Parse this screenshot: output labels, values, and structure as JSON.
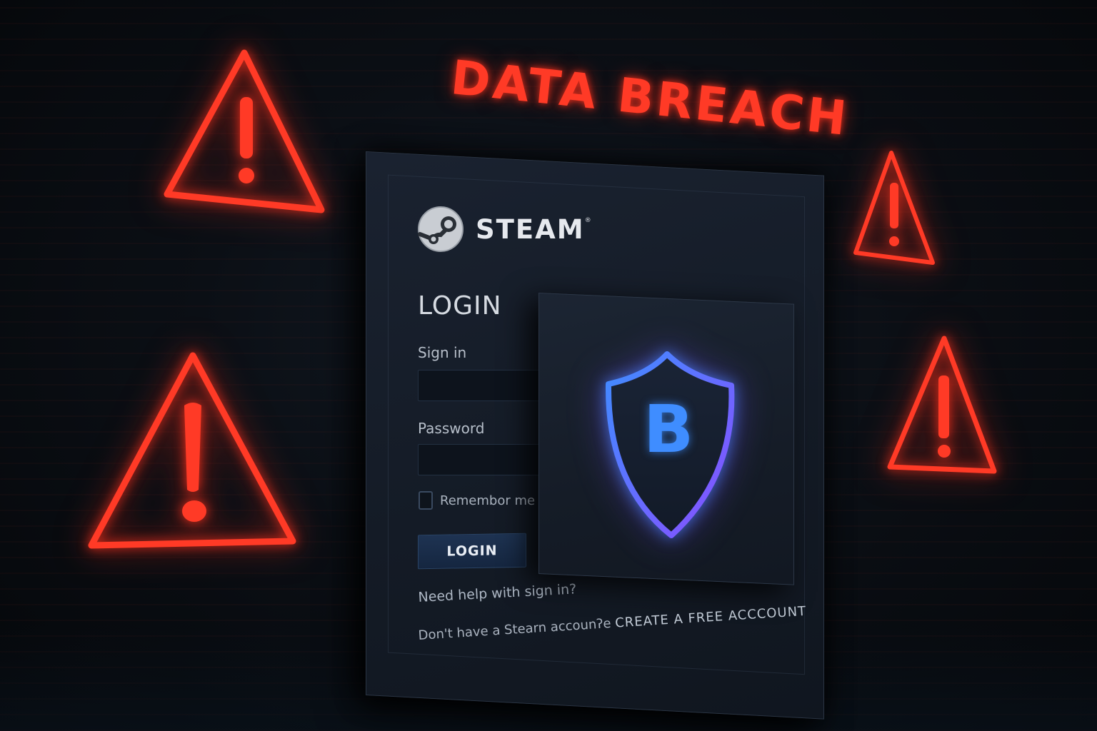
{
  "headline": "DATA BREACH",
  "brand": {
    "name": "STEAM",
    "trademark": "®",
    "logo_icon": "steam-logo-icon"
  },
  "login": {
    "title": "LOGIN",
    "signin_label": "Sign in",
    "signin_value": "",
    "password_label": "Password",
    "password_value": "",
    "remember_label": "Remembor me",
    "remember_checked": false,
    "button_label": "LOGIN",
    "help_link": "Need help with sign in?",
    "signup_prompt": "Don't have a Stearn accoun",
    "signup_glyph": "ʔe",
    "signup_link": "CREATE A FREE ACCCOUNT"
  },
  "security_badge": {
    "icon": "shield-icon",
    "letter": "B"
  },
  "warnings": {
    "icon": "warning-triangle-icon",
    "count": 4
  },
  "colors": {
    "alert_red": "#ff3a26",
    "shield_blue": "#3f8dff",
    "shield_violet": "#8a4dff",
    "panel_bg": "#161d28",
    "button_bg": "#1b2e4a"
  }
}
